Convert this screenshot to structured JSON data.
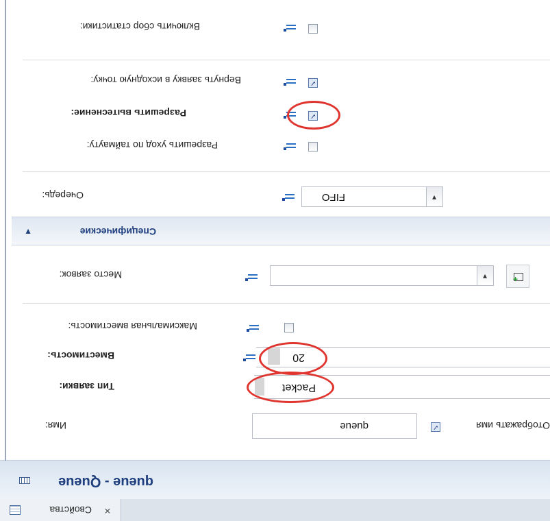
{
  "tab": {
    "label": "Свойства"
  },
  "header": {
    "title": "queue - Queue"
  },
  "sections": {
    "specific": "Специфические"
  },
  "rows": {
    "collect_statistics": {
      "label": "Включить сбор статистики:",
      "checked": false
    },
    "return_to_origin": {
      "label": "Вернуть заявку в исходную точку:",
      "checked": true
    },
    "allow_preemption": {
      "label": "Разрешить вытеснение:",
      "checked": true
    },
    "allow_timeout_exit": {
      "label": "Разрешить уход по таймауту:",
      "checked": false
    },
    "queue_order": {
      "label": "Очередь:",
      "value": "FIFO"
    },
    "location": {
      "label": "Место заявок:",
      "value": ""
    },
    "max_capacity": {
      "label": "Максимальная вместимость:",
      "checked": false
    },
    "capacity": {
      "label": "Вместимость:",
      "value": "20"
    },
    "request_type": {
      "label": "Тип заявки:",
      "value": "Packet"
    },
    "name": {
      "label": "Имя:",
      "value": "queue",
      "show_label": "Отображать имя",
      "show_checked": true
    }
  },
  "colors": {
    "accent": "#1f3f7f",
    "annotation": "#e0342f",
    "icon_blue": "#2b6fc2"
  },
  "icons": [
    "static-value-icon",
    "properties-view-icon",
    "queue-object-icon",
    "new-location-icon",
    "close-icon",
    "collapse-chevron-icon"
  ]
}
